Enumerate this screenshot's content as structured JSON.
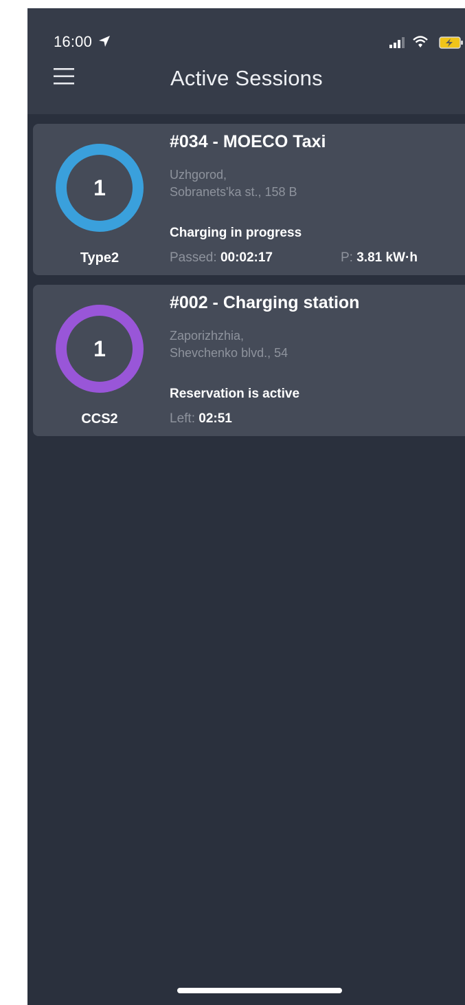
{
  "status_bar": {
    "time": "16:00",
    "icons": [
      "location-arrow-icon",
      "signal-icon",
      "wifi-icon",
      "battery-charging-icon"
    ]
  },
  "header": {
    "title": "Active Sessions",
    "menu_icon": "hamburger-menu-icon"
  },
  "colors": {
    "background": "#2a303d",
    "header": "#363c49",
    "card": "#454b58",
    "ring_blue": "#3aa0dc",
    "ring_purple": "#9956d8",
    "muted_text": "#8e939d"
  },
  "sessions": [
    {
      "connector_number": "1",
      "connector_type": "Type2",
      "ring_color": "#3aa0dc",
      "station_title": "#034 - MOECO Taxi",
      "address_line1": "Uzhgorod,",
      "address_line2": "Sobranets'ka st., 158 B",
      "status": "Charging in progress",
      "metric1_label": "Passed: ",
      "metric1_value": "00:02:17",
      "metric2_label": "P: ",
      "metric2_value": "3.81  kW·h"
    },
    {
      "connector_number": "1",
      "connector_type": "CCS2",
      "ring_color": "#9956d8",
      "station_title": "#002 - Charging station",
      "address_line1": "Zaporizhzhia,",
      "address_line2": "Shevchenko blvd., 54",
      "status": "Reservation is active",
      "metric1_label": "Left: ",
      "metric1_value": "02:51"
    }
  ]
}
